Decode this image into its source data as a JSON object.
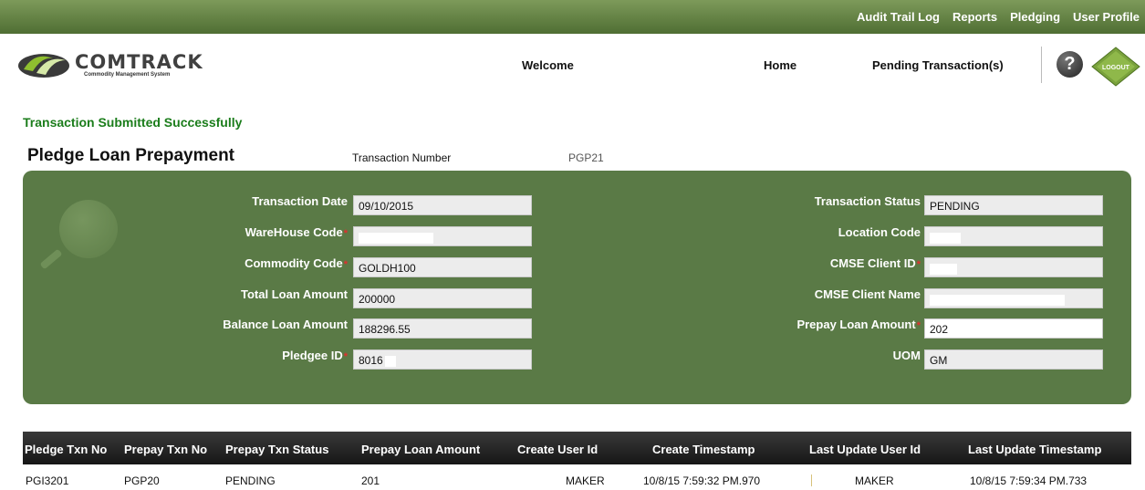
{
  "top_menu": [
    "Audit Trail Log",
    "Reports",
    "Pledging",
    "User Profile"
  ],
  "logo": {
    "name": "COMTRACK",
    "tagline": "Commodity Management System"
  },
  "header": {
    "welcome": "Welcome",
    "home": "Home",
    "pending": "Pending Transaction(s)",
    "help_symbol": "?",
    "logout": "LOGOUT"
  },
  "message": "Transaction Submitted Successfully",
  "page_title": "Pledge Loan Prepayment",
  "transaction": {
    "label": "Transaction Number",
    "value": "PGP21"
  },
  "form": {
    "left": [
      {
        "label": "Transaction Date",
        "required": false,
        "value": "09/10/2015"
      },
      {
        "label": "WareHouse Code",
        "required": true,
        "value": ""
      },
      {
        "label": "Commodity Code",
        "required": true,
        "value": "GOLDH100"
      },
      {
        "label": "Total Loan Amount",
        "required": false,
        "value": "200000"
      },
      {
        "label": "Balance Loan Amount",
        "required": false,
        "value": "188296.55"
      },
      {
        "label": "Pledgee ID",
        "required": true,
        "value": "8016"
      }
    ],
    "right": [
      {
        "label": "Transaction Status",
        "required": false,
        "value": "PENDING"
      },
      {
        "label": "Location Code",
        "required": false,
        "value": ""
      },
      {
        "label": "CMSE Client ID",
        "required": true,
        "value": ""
      },
      {
        "label": "CMSE Client Name",
        "required": false,
        "value": ""
      },
      {
        "label": "Prepay Loan Amount",
        "required": true,
        "value": "202"
      },
      {
        "label": "UOM",
        "required": false,
        "value": "GM"
      }
    ],
    "required_mark": "*"
  },
  "table": {
    "columns": [
      "Pledge Txn No",
      "Prepay Txn No",
      "Prepay Txn Status",
      "Prepay Loan Amount",
      "Create User Id",
      "Create Timestamp",
      "Last Update User Id",
      "Last Update Timestamp"
    ],
    "rows": [
      [
        "PGI3201",
        "PGP20",
        "PENDING",
        "201",
        "MAKER",
        "10/8/15 7:59:32 PM.970",
        "MAKER",
        "10/8/15 7:59:34 PM.733"
      ]
    ]
  },
  "colors": {
    "menu": "#5e7d3f",
    "panel": "#5a7a46",
    "success": "#1b7d1b",
    "required": "#e03030"
  }
}
